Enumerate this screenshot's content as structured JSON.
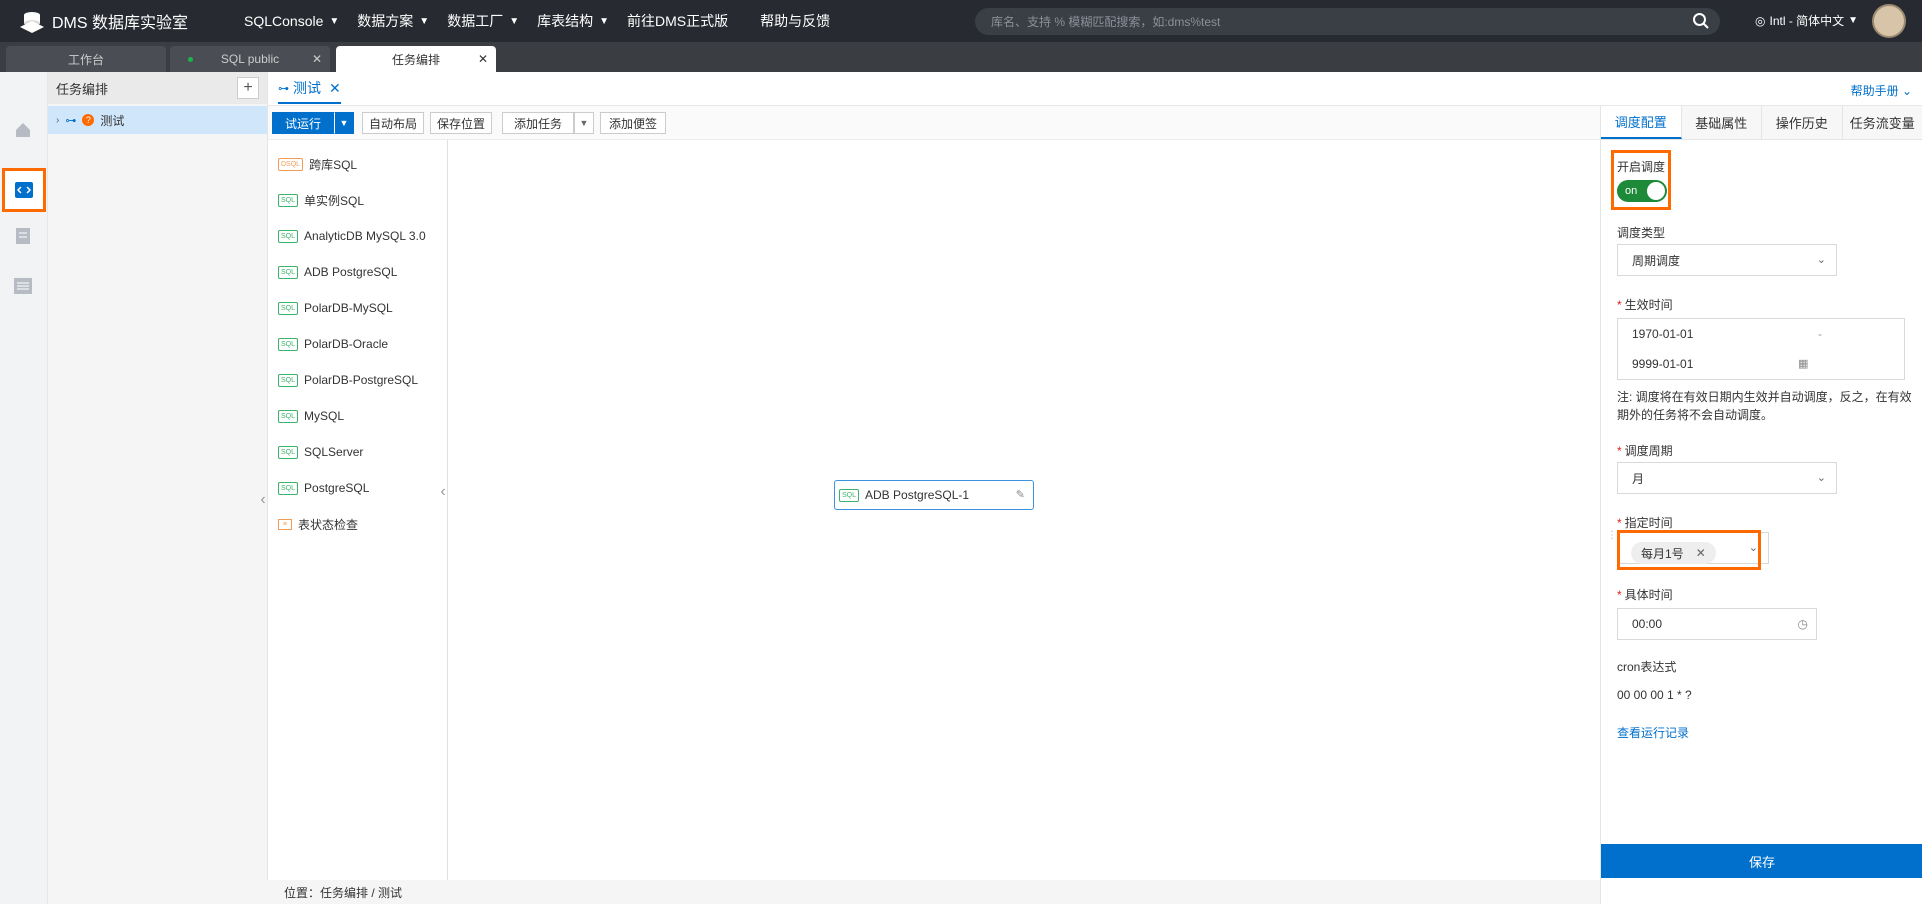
{
  "header": {
    "logo_text": "DMS 数据库实验室",
    "nav": [
      {
        "label": "SQLConsole",
        "dropdown": true
      },
      {
        "label": "数据方案",
        "dropdown": true
      },
      {
        "label": "数据工厂",
        "dropdown": true
      },
      {
        "label": "库表结构",
        "dropdown": true
      },
      {
        "label": "前往DMS正式版",
        "dropdown": false
      },
      {
        "label": "帮助与反馈",
        "dropdown": false
      }
    ],
    "search_placeholder": "库名、支持 % 模糊匹配搜索，如:dms%test",
    "language": "Intl - 简体中文"
  },
  "window_tabs": [
    {
      "label": "工作台",
      "active": false
    },
    {
      "label": "SQL public",
      "active": false
    },
    {
      "label": "任务编排",
      "active": true
    }
  ],
  "tree": {
    "title": "任务编排",
    "items": [
      {
        "label": "测试"
      }
    ]
  },
  "editor_tab": {
    "label": "测试",
    "help": "帮助手册"
  },
  "toolbar": {
    "run": "试运行",
    "auto_layout": "自动布局",
    "save_position": "保存位置",
    "add_task": "添加任务",
    "add_note": "添加便签"
  },
  "node_list": [
    {
      "label": "跨库SQL",
      "badge": "DSQL"
    },
    {
      "label": "单实例SQL",
      "badge": "SQL"
    },
    {
      "label": "AnalyticDB MySQL 3.0",
      "badge": "SQL"
    },
    {
      "label": "ADB PostgreSQL",
      "badge": "SQL"
    },
    {
      "label": "PolarDB-MySQL",
      "badge": "SQL"
    },
    {
      "label": "PolarDB-Oracle",
      "badge": "SQL"
    },
    {
      "label": "PolarDB-PostgreSQL",
      "badge": "SQL"
    },
    {
      "label": "MySQL",
      "badge": "SQL"
    },
    {
      "label": "SQLServer",
      "badge": "SQL"
    },
    {
      "label": "PostgreSQL",
      "badge": "SQL"
    },
    {
      "label": "表状态检查",
      "badge": ""
    }
  ],
  "canvas": {
    "node_label": "ADB PostgreSQL-1",
    "node_badge": "SQL"
  },
  "footer": {
    "location": "位置：任务编排 / 测试"
  },
  "config_panel": {
    "tabs": [
      "调度配置",
      "基础属性",
      "操作历史",
      "任务流变量"
    ],
    "enable_label": "开启调度",
    "toggle_text": "on",
    "schedule_type_label": "调度类型",
    "schedule_type_value": "周期调度",
    "effective_time_label": "生效时间",
    "start_date": "1970-01-01",
    "end_date": "9999-01-01",
    "date_separator": "-",
    "note": "注: 调度将在有效日期内生效并自动调度，反之，在有效期外的任务将不会自动调度。",
    "cycle_label": "调度周期",
    "cycle_value": "月",
    "specify_time_label": "指定时间",
    "specify_time_tag": "每月1号",
    "specific_time_label": "具体时间",
    "specific_time_value": "00:00",
    "cron_label": "cron表达式",
    "cron_value": "00 00 00 1 * ?",
    "run_record_link": "查看运行记录",
    "save": "保存"
  },
  "colors": {
    "accent": "#0070cc",
    "highlight": "#ff6a00",
    "toggle_on": "#1d8a3a"
  }
}
